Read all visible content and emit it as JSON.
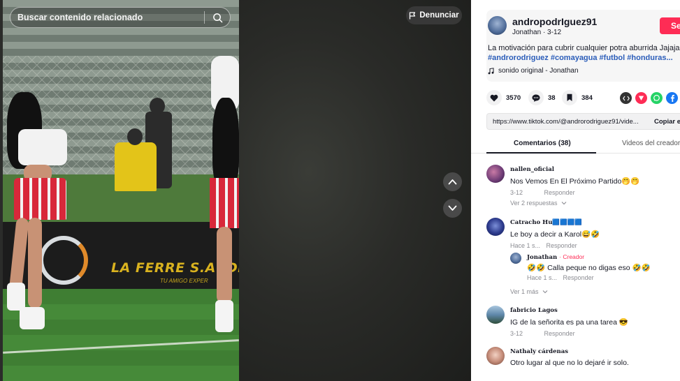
{
  "search": {
    "placeholder": "Buscar contenido relacionado"
  },
  "report": {
    "label": "Denunciar"
  },
  "video": {
    "banner_text": "LA FERRE S.A. DE C",
    "banner_sub": "TU AMIGO EXPER"
  },
  "author": {
    "username": "andrорodrIguez91",
    "display": "Jonathan",
    "date": "3-12",
    "follow_label": "Se"
  },
  "caption": {
    "text": "La motivación para cubrir cualquier potra aburrida Jajaja",
    "tags": "#androrodriguez #comayagua #futbol #honduras..."
  },
  "music": {
    "label": "sonido original - Jonathan"
  },
  "stats": {
    "likes": "3570",
    "comments": "38",
    "saves": "384"
  },
  "link": {
    "url": "https://www.tiktok.com/@androrodriguez91/vide...",
    "copy_label": "Copiar e"
  },
  "tabs": {
    "comments": "Comentarios (38)",
    "creator_videos": "Videos del creador"
  },
  "comments": [
    {
      "name": "nallen_oficial",
      "text": "Nos Vemos En El Próximo Partido🤭🤭",
      "date": "3-12",
      "reply": "Responder",
      "more": "Ver 2 respuestas"
    },
    {
      "name": "Catracho Hu🟦🟦🟦🟦",
      "text": "Le boy a decir a Karol😅🤣",
      "date": "Hace 1 s...",
      "reply": "Responder",
      "more": "Ver 1 más"
    },
    {
      "name": "fabricio Lagos",
      "text": "IG de la señorita es pa una tarea 😎",
      "date": "3-12",
      "reply": "Responder"
    },
    {
      "name": "Nathaly cárdenas",
      "text": "Otro lugar al que no lo dejaré ir solo.",
      "date": "",
      "reply": ""
    }
  ],
  "creator_reply": {
    "name": "Jonathan",
    "badge": "· Creador",
    "text": "🤣🤣 Calla peque no digas eso 🤣🤣",
    "date": "Hace 1 s...",
    "reply": "Responder"
  },
  "colors": {
    "accent": "#fe2c55",
    "tag": "#2b5db9",
    "muted": "#8a8b91"
  }
}
